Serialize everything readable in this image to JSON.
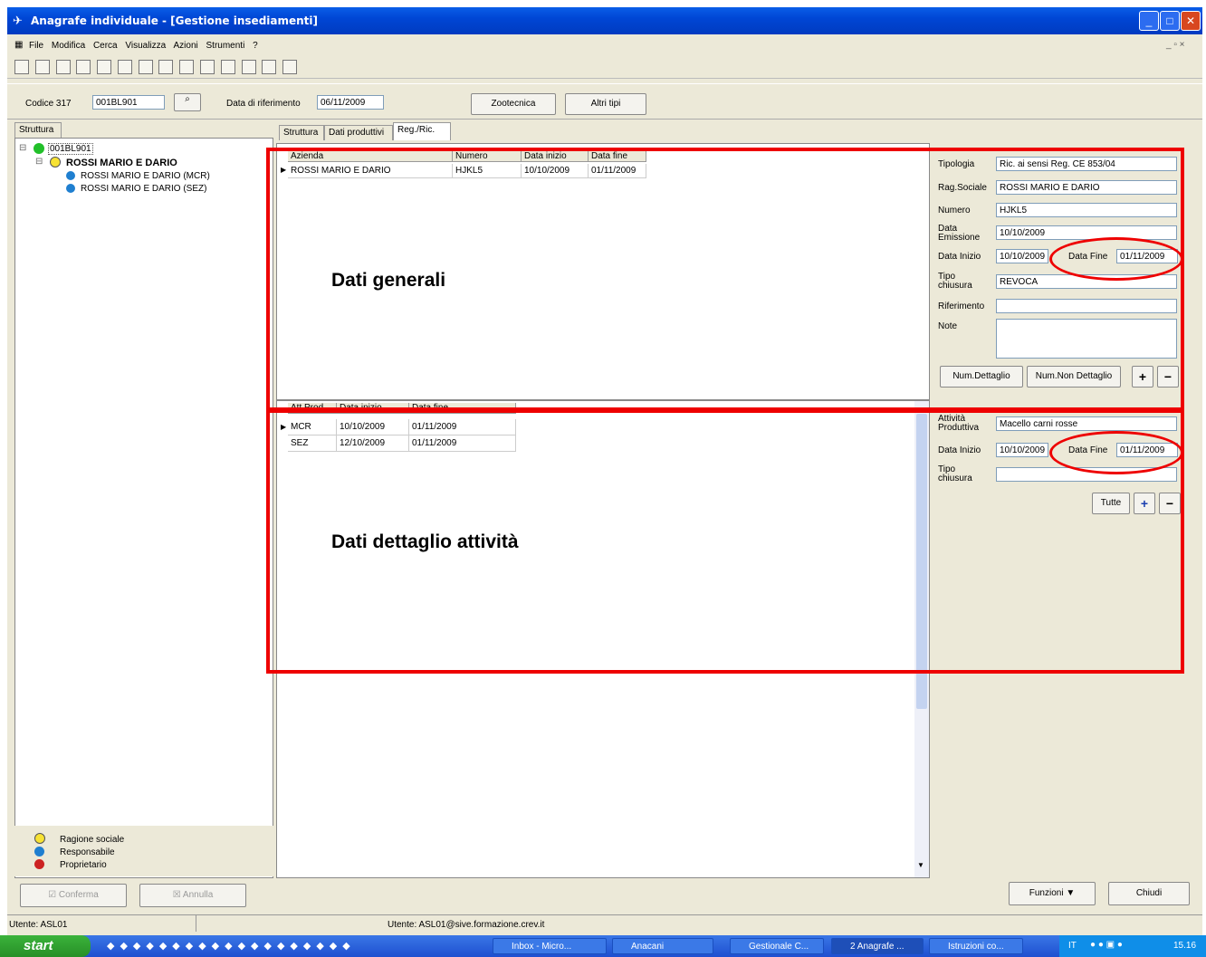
{
  "window": {
    "title": "Anagrafe individuale - [Gestione insediamenti]"
  },
  "menu": [
    "File",
    "Modifica",
    "Cerca",
    "Visualizza",
    "Azioni",
    "Strumenti",
    "?"
  ],
  "filter": {
    "codice_label": "Codice 317",
    "codice_value": "001BL901",
    "data_label": "Data di riferimento",
    "data_value": "06/11/2009",
    "zootecnica_label": "Zootecnica",
    "altri_tipi_label": "Altri tipi"
  },
  "left_panel": {
    "tab": "Struttura",
    "tree": {
      "root": "001BL901",
      "company": "ROSSI MARIO E DARIO",
      "children": [
        "ROSSI MARIO E DARIO (MCR)",
        "ROSSI MARIO E DARIO (SEZ)"
      ]
    },
    "legend": [
      "Ragione sociale",
      "Responsabile",
      "Proprietario"
    ]
  },
  "tabs": [
    "Struttura",
    "Dati produttivi",
    "Reg./Ric."
  ],
  "grid_top": {
    "headers": [
      "Azienda",
      "Numero",
      "Data inizio",
      "Data fine"
    ],
    "rows": [
      [
        "ROSSI MARIO E DARIO",
        "HJKL5",
        "10/10/2009",
        "01/11/2009"
      ]
    ]
  },
  "grid_bottom": {
    "headers": [
      "Att.Prod.",
      "Data inizio",
      "Data fine"
    ],
    "rows": [
      [
        "MCR",
        "10/10/2009",
        "01/11/2009"
      ],
      [
        "SEZ",
        "12/10/2009",
        "01/11/2009"
      ]
    ]
  },
  "form_top": {
    "tipologia_label": "Tipologia",
    "tipologia_value": "Ric. ai sensi Reg. CE 853/04",
    "rag_label": "Rag.Sociale",
    "rag_value": "ROSSI MARIO E DARIO",
    "numero_label": "Numero",
    "numero_value": "HJKL5",
    "emissione_label": "Data Emissione",
    "emissione_value": "10/10/2009",
    "inizio_label": "Data Inizio",
    "inizio_value": "10/10/2009",
    "fine_label": "Data Fine",
    "fine_value": "01/11/2009",
    "chiusura_label": "Tipo chiusura",
    "chiusura_value": "REVOCA",
    "riferimento_label": "Riferimento",
    "note_label": "Note",
    "num_dettaglio": "Num.Dettaglio",
    "num_non_dettaglio": "Num.Non Dettaglio",
    "plus": "+",
    "minus": "−"
  },
  "form_bottom": {
    "attivita_label": "Attività Produttiva",
    "attivita_value": "Macello carni rosse",
    "inizio_label": "Data Inizio",
    "inizio_value": "10/10/2009",
    "fine_label": "Data Fine",
    "fine_value": "01/11/2009",
    "chiusura_label": "Tipo chiusura",
    "tutte": "Tutte",
    "plus": "+",
    "minus": "−"
  },
  "annotations": {
    "top": "Dati generali",
    "bottom": "Dati dettaglio attività"
  },
  "bottom_buttons": {
    "conferma": "Conferma",
    "annulla": "Annulla",
    "funzioni": "Funzioni ▼",
    "chiudi": "Chiudi"
  },
  "status": {
    "left": "Utente: ASL01",
    "center": "Utente: ASL01@sive.formazione.crev.it"
  },
  "taskbar": {
    "start": "start",
    "tasks": [
      "Inbox - Micro...",
      "Anacani",
      "Gestionale C...",
      "2 Anagrafe ...",
      "Istruzioni co..."
    ],
    "lang": "IT",
    "clock": "15.16"
  },
  "colors": {
    "annotation": "#ee0000",
    "title_bar": "#0046d5",
    "tree_root": "#22c02a"
  }
}
